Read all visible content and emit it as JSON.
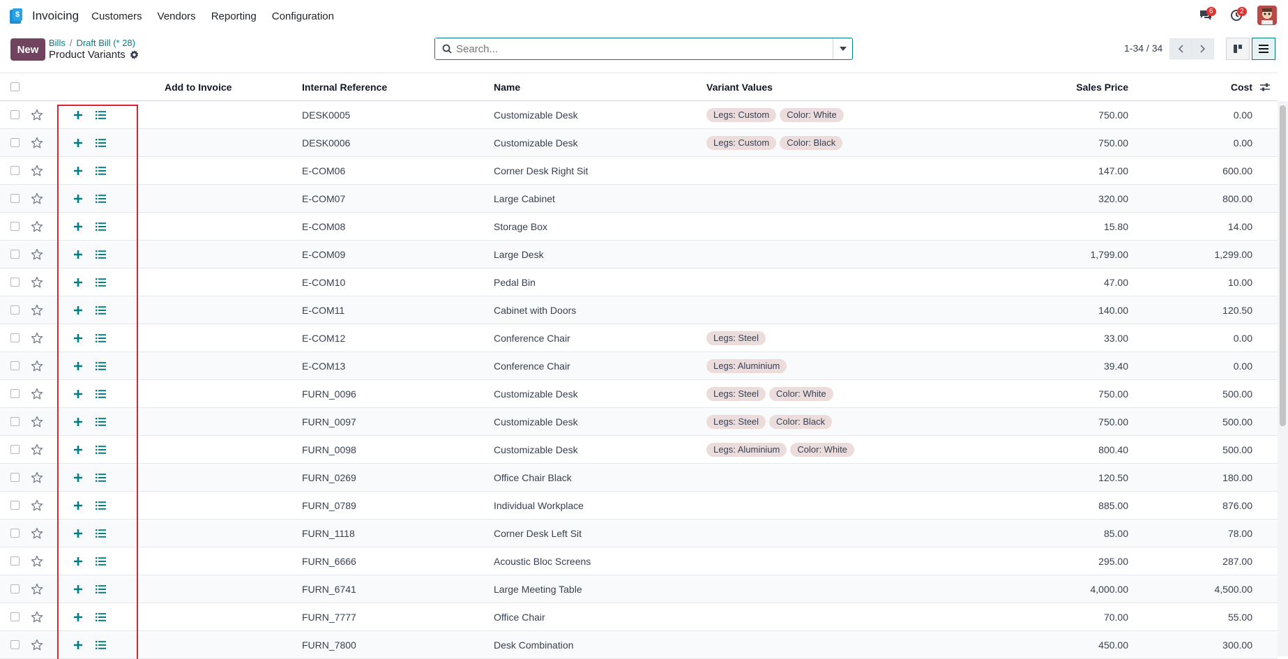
{
  "app": {
    "name": "Invoicing",
    "menu": [
      "Customers",
      "Vendors",
      "Reporting",
      "Configuration"
    ]
  },
  "notifications": {
    "messages_count": "6",
    "activities_count": "2"
  },
  "controls": {
    "new_label": "New",
    "breadcrumb": [
      "Bills",
      "Draft Bill (* 28)"
    ],
    "title": "Product Variants",
    "search_placeholder": "Search...",
    "pager": "1-34 / 34"
  },
  "columns": {
    "add_to_invoice": "Add to Invoice",
    "internal_reference": "Internal Reference",
    "name": "Name",
    "variant_values": "Variant Values",
    "sales_price": "Sales Price",
    "cost": "Cost"
  },
  "rows": [
    {
      "ref": "DESK0005",
      "name": "Customizable Desk",
      "tags": [
        "Legs: Custom",
        "Color: White"
      ],
      "price": "750.00",
      "cost": "0.00"
    },
    {
      "ref": "DESK0006",
      "name": "Customizable Desk",
      "tags": [
        "Legs: Custom",
        "Color: Black"
      ],
      "price": "750.00",
      "cost": "0.00"
    },
    {
      "ref": "E-COM06",
      "name": "Corner Desk Right Sit",
      "tags": [],
      "price": "147.00",
      "cost": "600.00"
    },
    {
      "ref": "E-COM07",
      "name": "Large Cabinet",
      "tags": [],
      "price": "320.00",
      "cost": "800.00"
    },
    {
      "ref": "E-COM08",
      "name": "Storage Box",
      "tags": [],
      "price": "15.80",
      "cost": "14.00"
    },
    {
      "ref": "E-COM09",
      "name": "Large Desk",
      "tags": [],
      "price": "1,799.00",
      "cost": "1,299.00"
    },
    {
      "ref": "E-COM10",
      "name": "Pedal Bin",
      "tags": [],
      "price": "47.00",
      "cost": "10.00"
    },
    {
      "ref": "E-COM11",
      "name": "Cabinet with Doors",
      "tags": [],
      "price": "140.00",
      "cost": "120.50"
    },
    {
      "ref": "E-COM12",
      "name": "Conference Chair",
      "tags": [
        "Legs: Steel"
      ],
      "price": "33.00",
      "cost": "0.00"
    },
    {
      "ref": "E-COM13",
      "name": "Conference Chair",
      "tags": [
        "Legs: Aluminium"
      ],
      "price": "39.40",
      "cost": "0.00"
    },
    {
      "ref": "FURN_0096",
      "name": "Customizable Desk",
      "tags": [
        "Legs: Steel",
        "Color: White"
      ],
      "price": "750.00",
      "cost": "500.00"
    },
    {
      "ref": "FURN_0097",
      "name": "Customizable Desk",
      "tags": [
        "Legs: Steel",
        "Color: Black"
      ],
      "price": "750.00",
      "cost": "500.00"
    },
    {
      "ref": "FURN_0098",
      "name": "Customizable Desk",
      "tags": [
        "Legs: Aluminium",
        "Color: White"
      ],
      "price": "800.40",
      "cost": "500.00"
    },
    {
      "ref": "FURN_0269",
      "name": "Office Chair Black",
      "tags": [],
      "price": "120.50",
      "cost": "180.00"
    },
    {
      "ref": "FURN_0789",
      "name": "Individual Workplace",
      "tags": [],
      "price": "885.00",
      "cost": "876.00"
    },
    {
      "ref": "FURN_1118",
      "name": "Corner Desk Left Sit",
      "tags": [],
      "price": "85.00",
      "cost": "78.00"
    },
    {
      "ref": "FURN_6666",
      "name": "Acoustic Bloc Screens",
      "tags": [],
      "price": "295.00",
      "cost": "287.00"
    },
    {
      "ref": "FURN_6741",
      "name": "Large Meeting Table",
      "tags": [],
      "price": "4,000.00",
      "cost": "4,500.00"
    },
    {
      "ref": "FURN_7777",
      "name": "Office Chair",
      "tags": [],
      "price": "70.00",
      "cost": "55.00"
    },
    {
      "ref": "FURN_7800",
      "name": "Desk Combination",
      "tags": [],
      "price": "450.00",
      "cost": "300.00"
    }
  ]
}
